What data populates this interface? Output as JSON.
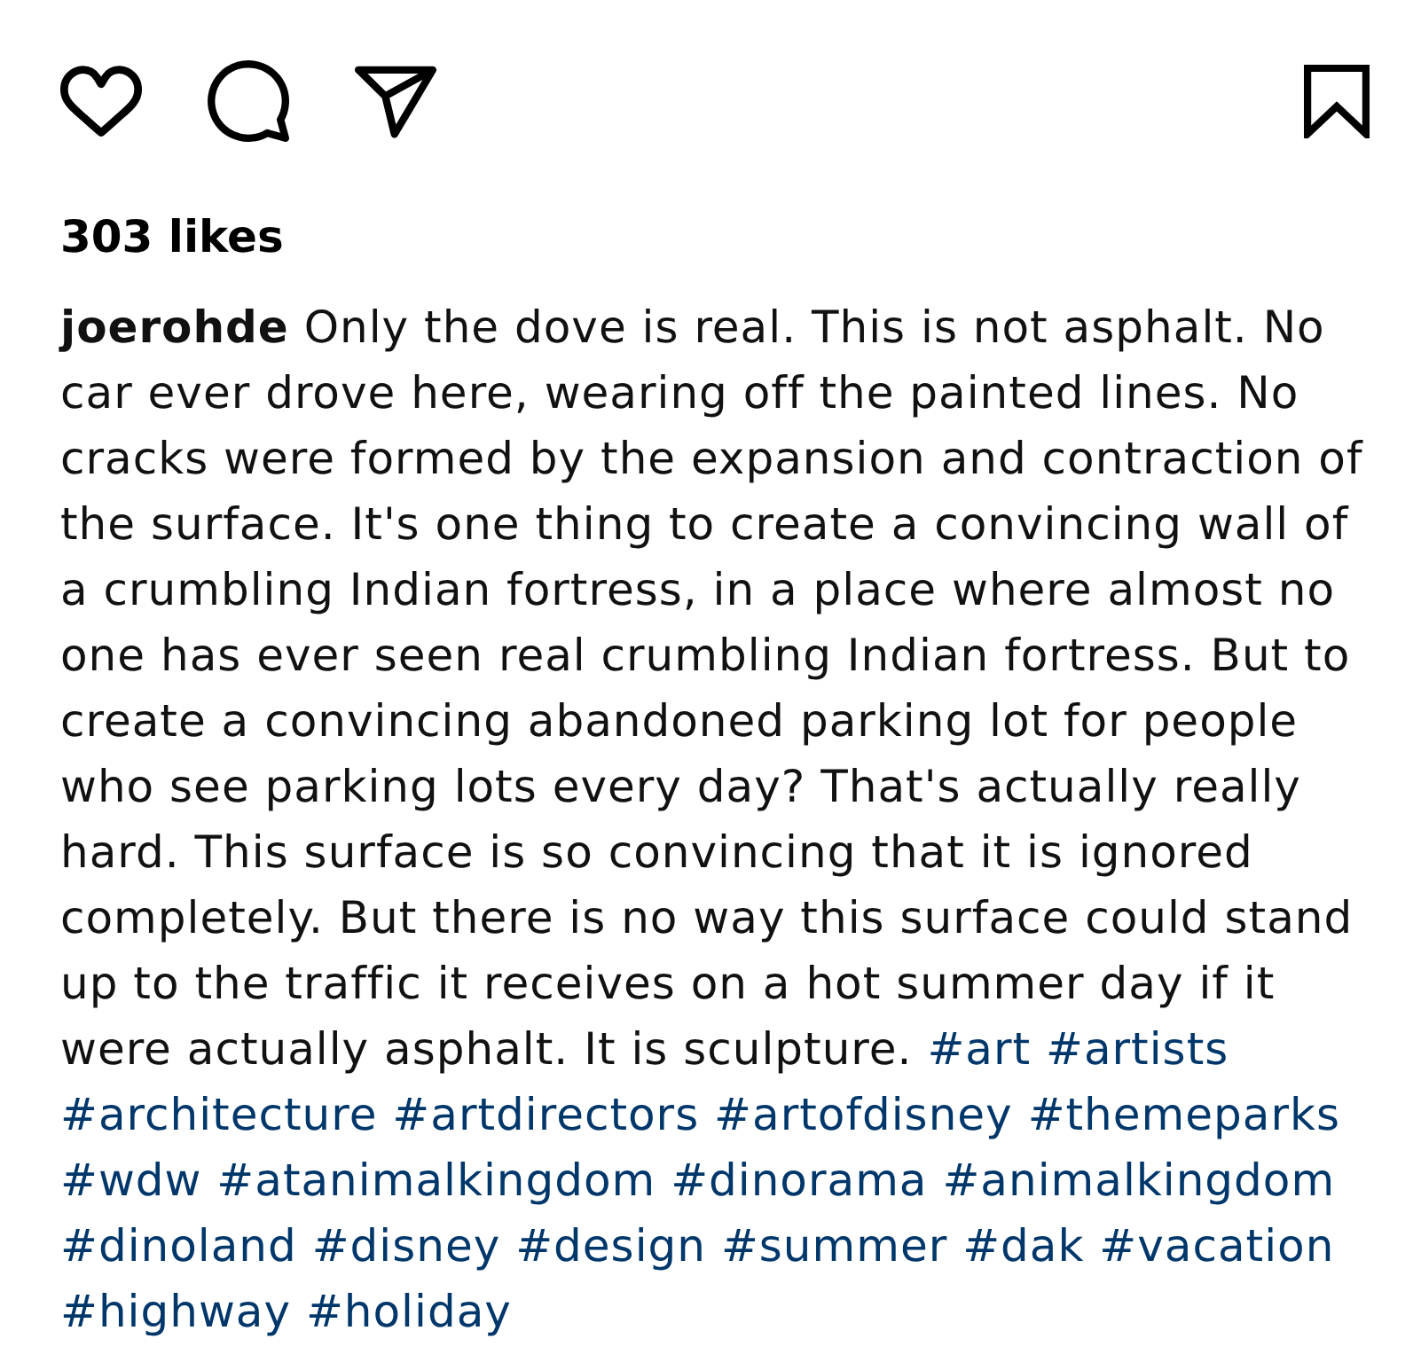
{
  "likes": "303 likes",
  "caption": {
    "username": "joerohde",
    "text": "Only the dove is real. This is not asphalt. No car ever drove here, wearing off the painted lines. No cracks were formed by the expansion and contraction of the surface. It's one thing to create a convincing wall of a crumbling Indian fortress, in a place where almost no one has ever seen real crumbling Indian fortress. But to create a convincing abandoned parking lot for people who see parking lots every day? That's actually really hard. This surface is so convincing that it is ignored completely. But there is no way this surface could stand up to the traffic it receives on a hot summer day if it were actually asphalt. It is sculpture.",
    "hashtags": [
      "#art",
      "#artists",
      "#architecture",
      "#artdirectors",
      "#artofdisney",
      "#themeparks",
      "#wdw",
      "#atanimalkingdom",
      "#dinorama",
      "#animalkingdom",
      "#dinoland",
      "#disney",
      "#design",
      "#summer",
      "#dak",
      "#vacation",
      "#highway",
      "#holiday"
    ]
  }
}
